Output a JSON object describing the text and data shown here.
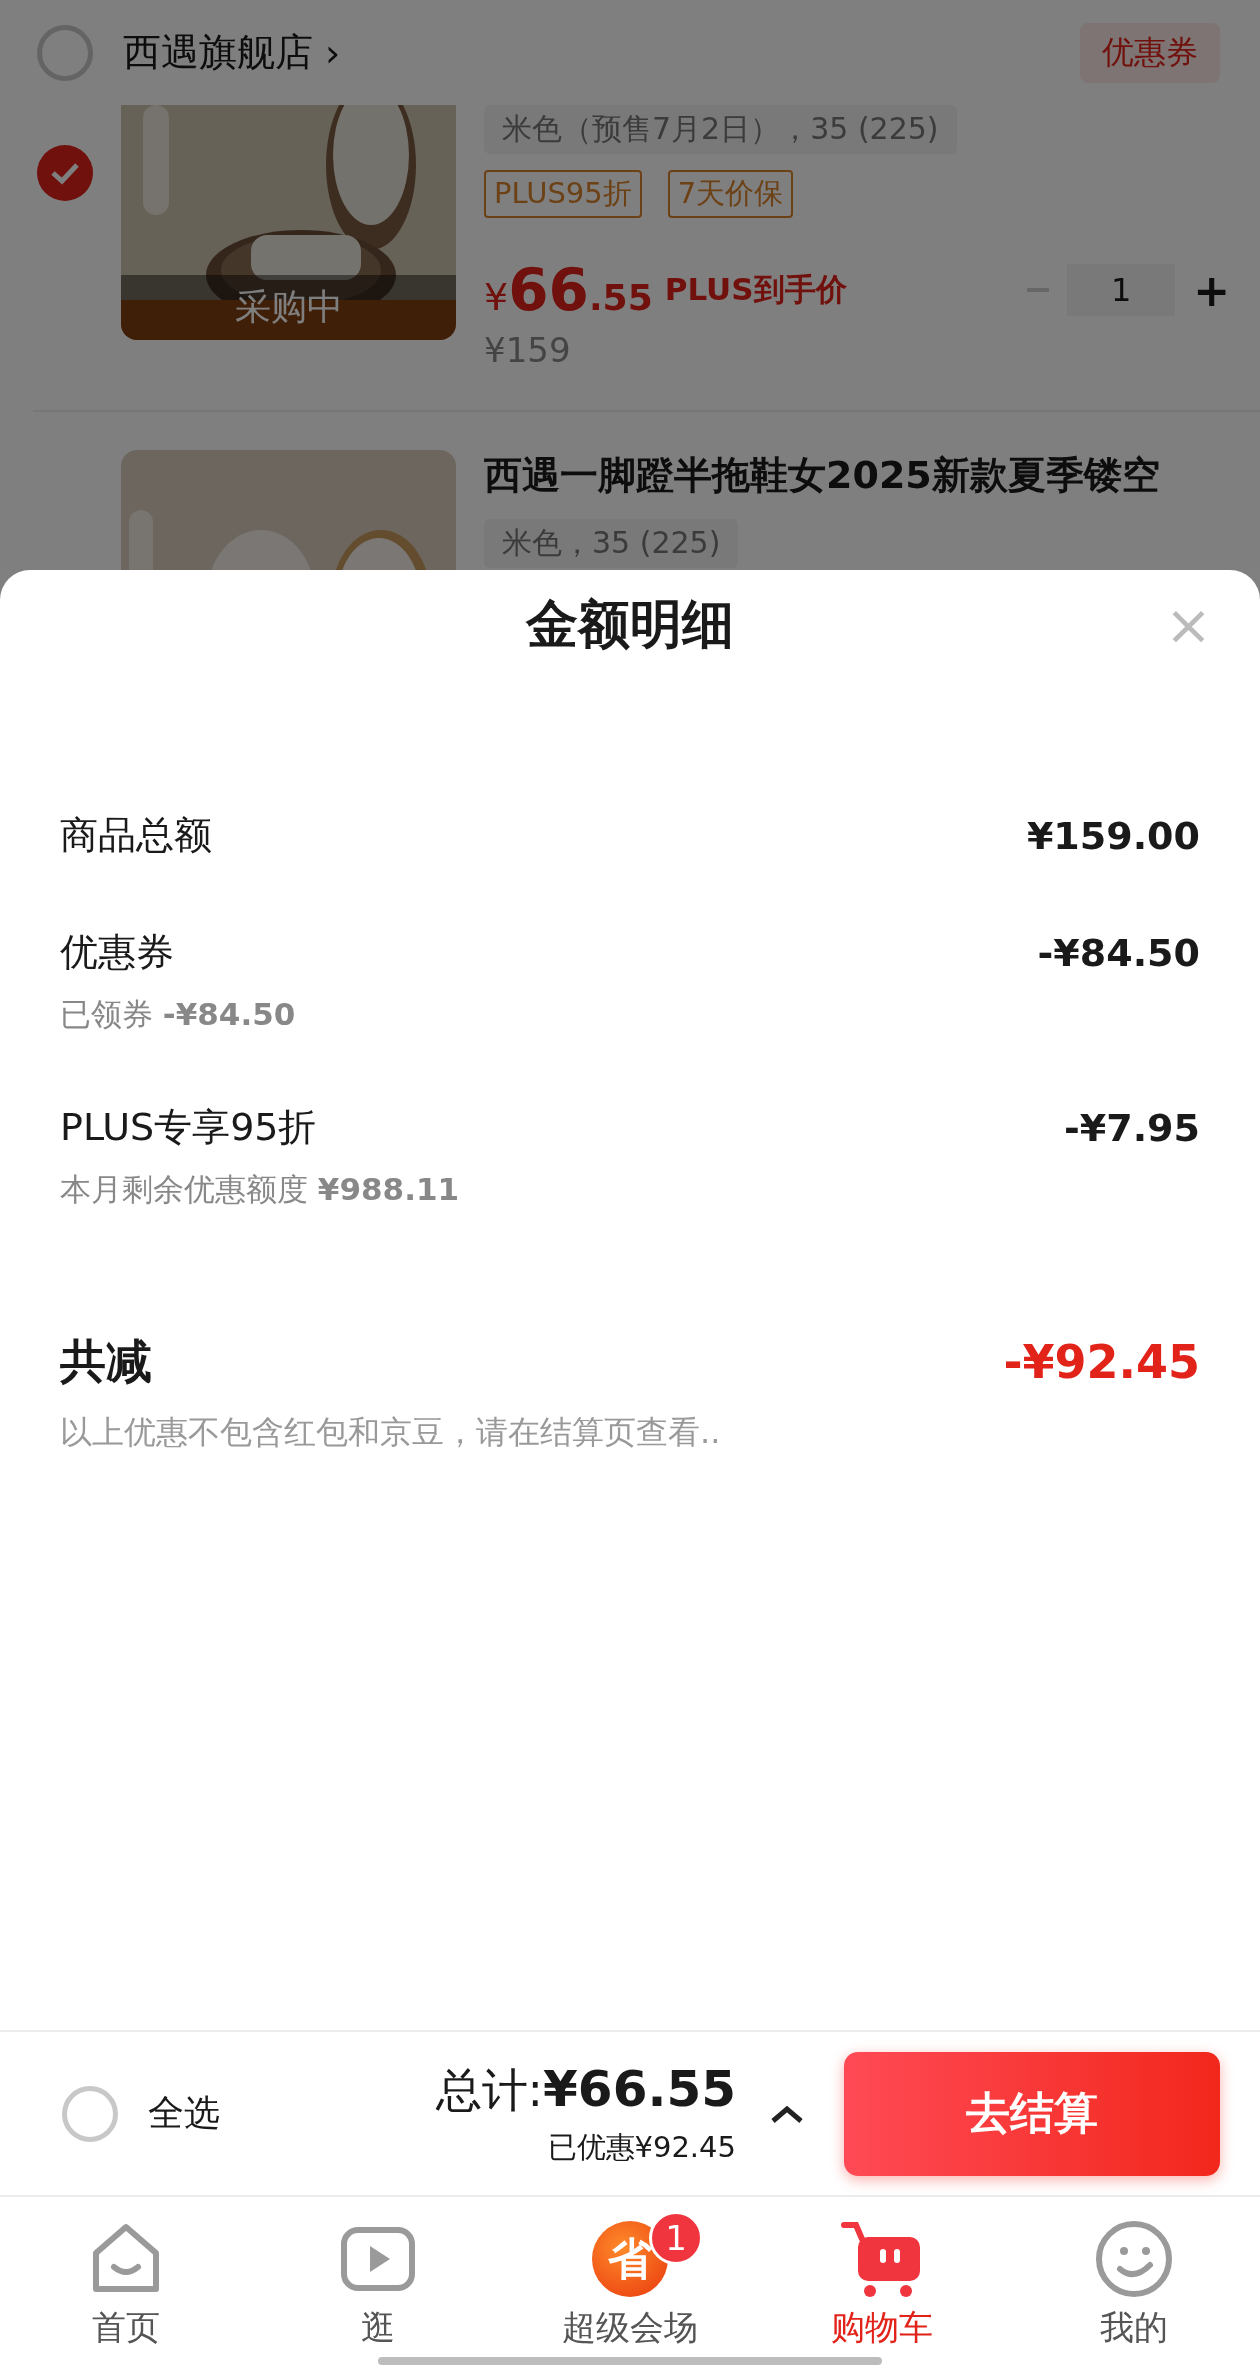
{
  "store": {
    "checked": false,
    "name": "西遇旗舰店",
    "chevron": "›",
    "coupon": "优惠券"
  },
  "items": [
    {
      "checked": true,
      "variant": "米色（预售7月2日），35 (225)",
      "status": "采购中",
      "tags": [
        "PLUS95折",
        "7天价保"
      ],
      "currency": "¥",
      "price_int": "66",
      "price_dec": ".55",
      "price_label": "PLUS到手价",
      "original_price": "¥159",
      "quantity": "1",
      "plus": "+"
    },
    {
      "title": "西遇一脚蹬半拖鞋女2025新款夏季镂空",
      "variant": "米色，35 (225)"
    }
  ],
  "sheet": {
    "title": "金额明细",
    "close": "×",
    "rows": [
      {
        "label": "商品总额",
        "amount": "¥159.00"
      },
      {
        "label": "优惠券",
        "amount": "-¥84.50",
        "note": "已领券",
        "note_amount": "-¥84.50"
      },
      {
        "label": "PLUS专享95折",
        "amount": "-¥7.95",
        "note": "本月剩余优惠额度",
        "note_amount": "¥988.11"
      }
    ],
    "total": {
      "label": "共减",
      "amount": "-¥92.45"
    },
    "footnote": "以上优惠不包含红包和京豆，请在结算页查看.."
  },
  "footer": {
    "select_all": {
      "label": "全选",
      "checked": false
    },
    "total_label": "总计:",
    "total": "¥66.55",
    "saved": "已优惠¥92.45",
    "checkout": "去结算"
  },
  "tabs": [
    {
      "kind": "home",
      "label": "首页",
      "selected": false
    },
    {
      "kind": "video",
      "label": "逛",
      "selected": false
    },
    {
      "kind": "save",
      "label": "超级会场",
      "selected": false,
      "icon_text": "省",
      "badge": "1"
    },
    {
      "kind": "cart",
      "label": "购物车",
      "selected": true
    },
    {
      "kind": "me",
      "label": "我的",
      "selected": false
    }
  ]
}
